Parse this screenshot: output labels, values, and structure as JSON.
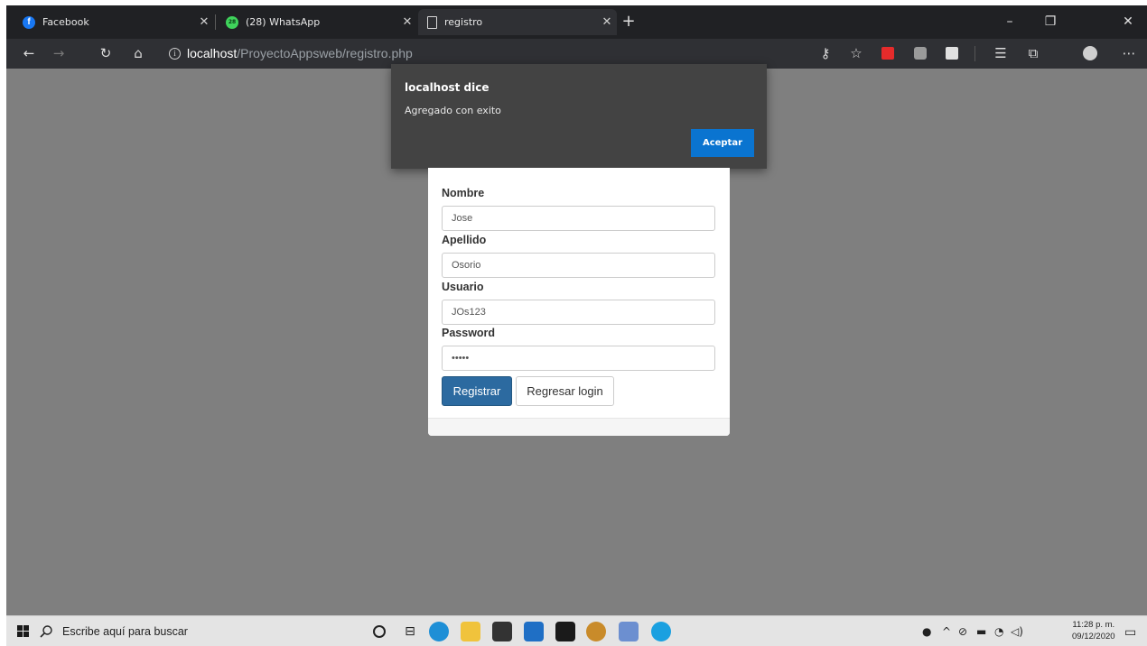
{
  "browser": {
    "tabs": [
      {
        "title": "Facebook"
      },
      {
        "title": "(28) WhatsApp"
      },
      {
        "title": "registro"
      }
    ],
    "url_host": "localhost",
    "url_path": "/ProyectoAppsweb/registro.php"
  },
  "dialog": {
    "title": "localhost dice",
    "message": "Agregado con exito",
    "ok_label": "Aceptar"
  },
  "form": {
    "fields": [
      {
        "label": "Nombre",
        "value": "Jose"
      },
      {
        "label": "Apellido",
        "value": "Osorio"
      },
      {
        "label": "Usuario",
        "value": "JOs123"
      },
      {
        "label": "Password",
        "value": "•••••"
      }
    ],
    "register_label": "Registrar",
    "back_label": "Regresar login"
  },
  "taskbar": {
    "search_placeholder": "Escribe aquí para buscar",
    "time": "11:28 p. m.",
    "date": "09/12/2020"
  },
  "colors": {
    "overlay": "#7f7f7f",
    "dialog_bg": "#434343",
    "dialog_button": "#0a74d0",
    "primary_button": "#2c6aa0"
  }
}
